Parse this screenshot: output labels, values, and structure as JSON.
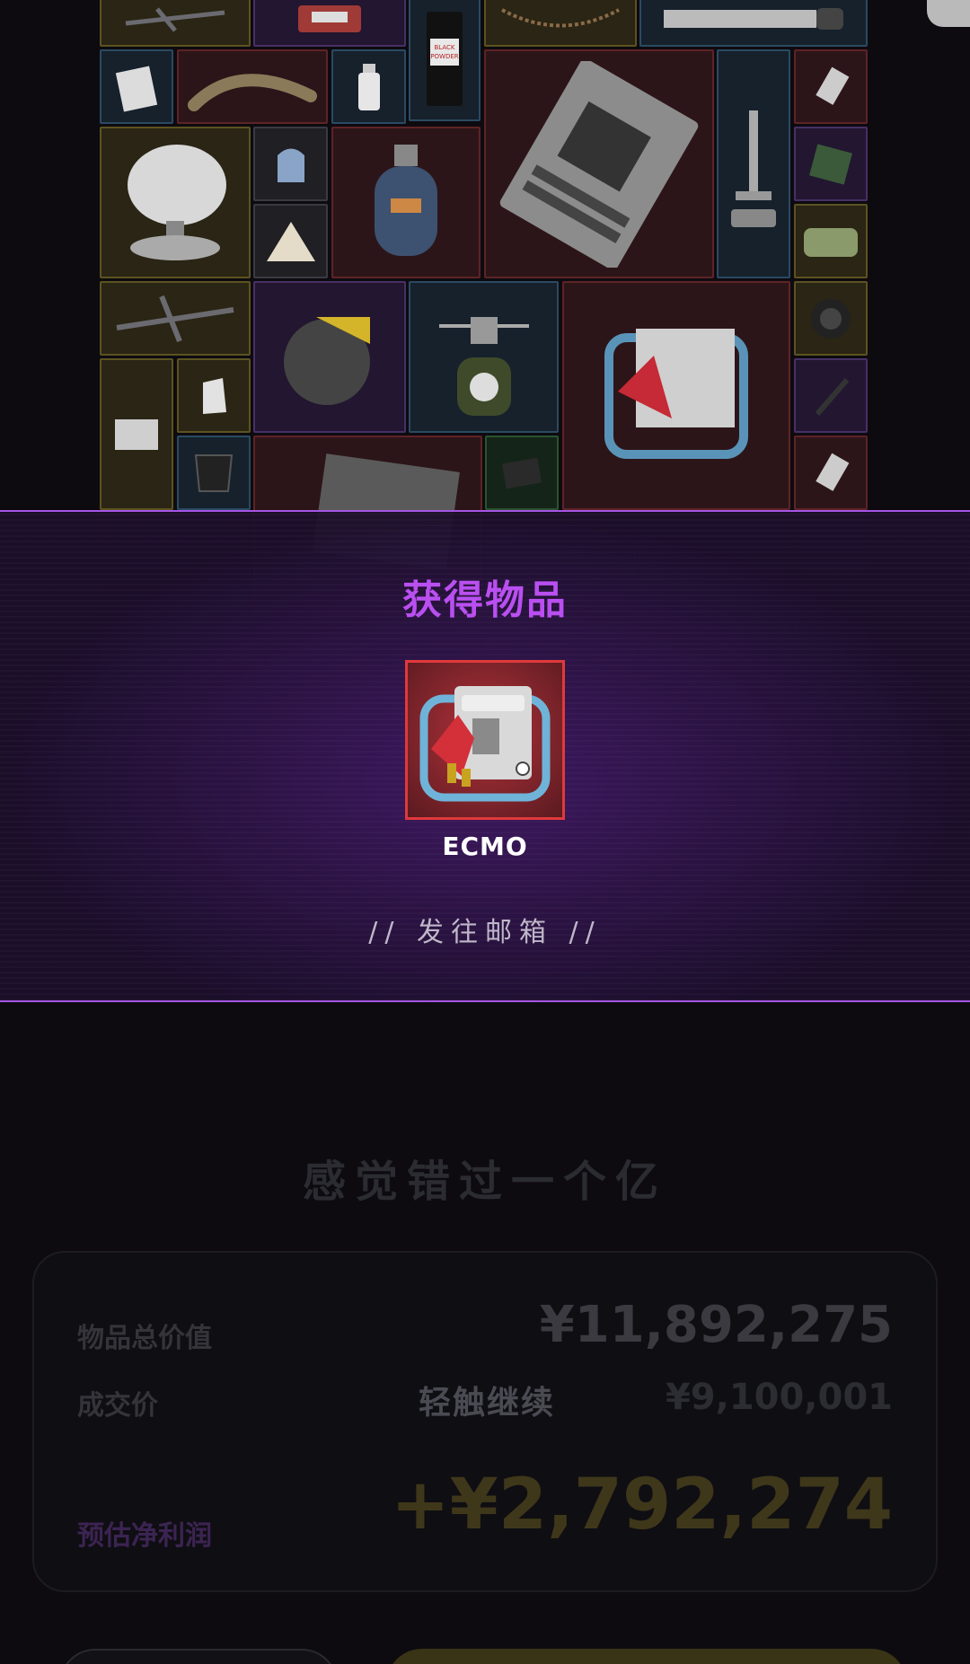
{
  "banner": {
    "title": "获得物品",
    "item_name": "ECMO",
    "mail_text": "// 发往邮箱 //",
    "item_rarity_color": "#e0393a"
  },
  "summary": {
    "slogan": "感觉错过一个亿",
    "total_value_label": "物品总价值",
    "total_value": "¥11,892,275",
    "deal_price_label": "成交价",
    "deal_price": "¥9,100,001",
    "continue_hint": "轻触继续",
    "profit_label": "预估净利润",
    "profit_value": "+¥2,792,274"
  },
  "colors": {
    "accent_purple": "#b94ff0",
    "banner_border": "#a655e6",
    "profit_gold": "#3f371a"
  },
  "grid_items": [
    {
      "name": "crossbow-item",
      "rarity": "yellow",
      "icon": "crossbow-icon"
    },
    {
      "name": "sos-kit-item",
      "rarity": "purple",
      "icon": "kit-icon",
      "label": "SOS"
    },
    {
      "name": "black-powder-item",
      "rarity": "blue",
      "icon": "bottle-icon",
      "label": "BLACK POWDER"
    },
    {
      "name": "chain-necklace-item",
      "rarity": "yellow",
      "icon": "necklace-icon"
    },
    {
      "name": "saw-blade-item",
      "rarity": "blue",
      "icon": "saw-icon"
    },
    {
      "name": "memory-card-item",
      "rarity": "blue",
      "icon": "card-icon"
    },
    {
      "name": "claw-fossil-item",
      "rarity": "red",
      "icon": "claw-icon"
    },
    {
      "name": "medicine-bottle-item",
      "rarity": "blue",
      "icon": "bottle-icon"
    },
    {
      "name": "motherboard-item",
      "rarity": "red",
      "icon": "motherboard-icon"
    },
    {
      "name": "microscope-item",
      "rarity": "blue",
      "icon": "microscope-icon"
    },
    {
      "name": "usb-drive-item",
      "rarity": "red",
      "icon": "usb-icon"
    },
    {
      "name": "circuit-chip-item",
      "rarity": "purple",
      "icon": "chip-icon"
    },
    {
      "name": "radar-dish-item",
      "rarity": "yellow",
      "icon": "radar-icon"
    },
    {
      "name": "gloves-item",
      "rarity": "gray",
      "icon": "glove-icon"
    },
    {
      "name": "gas-tank-item",
      "rarity": "red",
      "icon": "gas-tank-icon"
    },
    {
      "name": "tin-can-item",
      "rarity": "yellow",
      "icon": "tin-icon"
    },
    {
      "name": "triangle-pack-item",
      "rarity": "yellow",
      "icon": "triangle-icon"
    },
    {
      "name": "crossbow-2-item",
      "rarity": "yellow",
      "icon": "crossbow-icon"
    },
    {
      "name": "circular-saw-item",
      "rarity": "purple",
      "icon": "saw-icon"
    },
    {
      "name": "camp-stove-item",
      "rarity": "blue",
      "icon": "stove-icon"
    },
    {
      "name": "ecmo-item",
      "rarity": "red",
      "icon": "ecmo-icon"
    },
    {
      "name": "lens-item",
      "rarity": "yellow",
      "icon": "lens-icon"
    },
    {
      "name": "map-paper-item",
      "rarity": "yellow",
      "icon": "paper-icon"
    },
    {
      "name": "ceramic-item",
      "rarity": "yellow",
      "icon": "ceramic-icon"
    },
    {
      "name": "knife-item",
      "rarity": "purple",
      "icon": "knife-icon"
    },
    {
      "name": "face-shield-item",
      "rarity": "blue",
      "icon": "shield-icon"
    },
    {
      "name": "server-rack-item",
      "rarity": "red",
      "icon": "server-icon"
    },
    {
      "name": "tablet-item",
      "rarity": "green",
      "icon": "tablet-icon"
    },
    {
      "name": "usb-drive-2-item",
      "rarity": "red",
      "icon": "usb-icon"
    }
  ]
}
